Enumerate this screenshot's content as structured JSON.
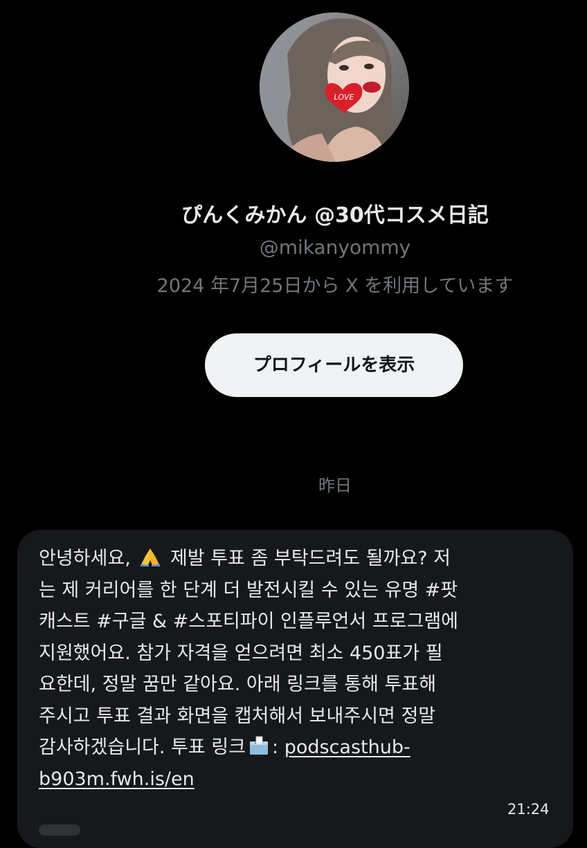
{
  "profile": {
    "display_name": "ぴんくみかん @30代コスメ日記",
    "handle": "@mikanyommy",
    "joined": "2024 年7月25日から X を利用しています",
    "view_profile_label": "プロフィールを表示",
    "avatar_badge_text": "LOVE"
  },
  "conversation": {
    "date_divider": "昨日"
  },
  "message": {
    "lines": [
      "안녕하세요, ",
      " 제발 투표 좀 부탁드려도 될까요? 저",
      "는 제 커리어를 한 단계 더 발전시킬 수 있는 유명 #팟",
      "캐스트 #구글 & #스포티파이 인플루언서 프로그램에",
      "지원했어요. 참가 자격을 얻으려면 최소 450표가 필",
      "요한데, 정말 꿈만 같아요. 아래 링크를 통해 투표해",
      "주시고 투표 결과 화면을 캡처해서 보내주시면 정말",
      "감사하겠습니다. 투표 링크",
      ": ",
      "podscasthub-",
      "b903m.fwh.is/en"
    ],
    "emoji_1": "folded-hands-icon",
    "emoji_2": "ballot-box-icon",
    "timestamp": "21:24"
  },
  "colors": {
    "background": "#000000",
    "bubble": "#16181c",
    "primary_text": "#e7e9ea",
    "secondary_text": "#71767b",
    "button_bg": "#eff3f4",
    "button_text": "#0f1419",
    "avatar_heart": "#d8202b"
  }
}
